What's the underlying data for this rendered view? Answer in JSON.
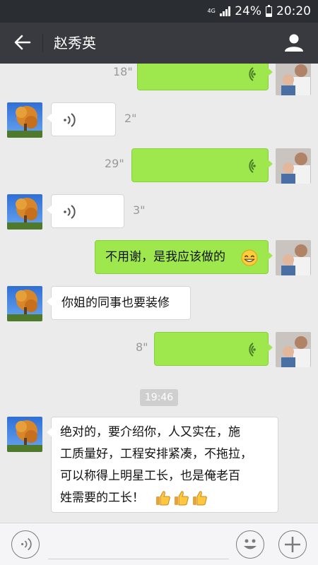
{
  "status_bar": {
    "network": "4G",
    "battery": "24%",
    "time": "20:20"
  },
  "header": {
    "title": "赵秀英"
  },
  "messages": [
    {
      "side": "out",
      "type": "voice",
      "duration": "18\""
    },
    {
      "side": "in",
      "type": "voice",
      "duration": "2\""
    },
    {
      "side": "out",
      "type": "voice",
      "duration": "29\""
    },
    {
      "side": "in",
      "type": "voice",
      "duration": "3\""
    },
    {
      "side": "out",
      "type": "text",
      "text": "不用谢，是我应该做的"
    },
    {
      "side": "in",
      "type": "text",
      "text": "你姐的同事也要装修"
    },
    {
      "side": "out",
      "type": "voice",
      "duration": "8\""
    },
    {
      "type": "time",
      "text": "19:46"
    },
    {
      "side": "in",
      "type": "text",
      "lines": [
        "绝对的，要介绍你，人又实在，施",
        "工质量好，工程安排紧凑，不拖拉，",
        "可以称得上明星工长，也是俺老百",
        "姓需要的工长！"
      ]
    }
  ],
  "colors": {
    "header_bg": "#393a3f",
    "status_bg": "#2a2d32",
    "chat_bg": "#ebebeb",
    "out_bubble": "#9ee84e",
    "in_bubble": "#ffffff"
  }
}
